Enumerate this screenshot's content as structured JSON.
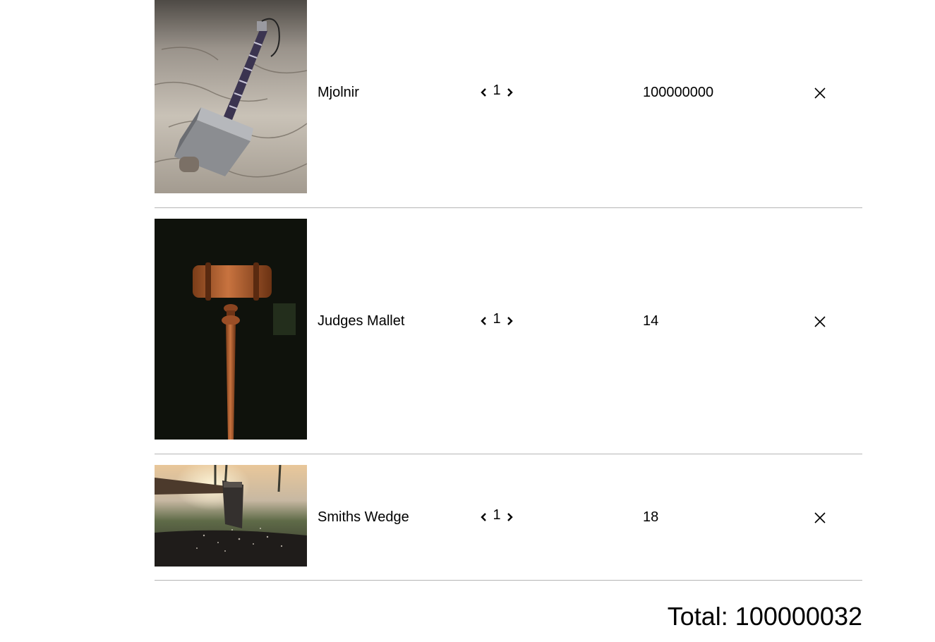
{
  "cart": {
    "items": [
      {
        "name": "Mjolnir",
        "quantity": "1",
        "price": "100000000"
      },
      {
        "name": "Judges Mallet",
        "quantity": "1",
        "price": "14"
      },
      {
        "name": "Smiths Wedge",
        "quantity": "1",
        "price": "18"
      }
    ],
    "total": "Total: 100000032"
  },
  "icons": {
    "decrease": "chevron-left-icon",
    "increase": "chevron-right-icon",
    "remove": "close-icon"
  }
}
